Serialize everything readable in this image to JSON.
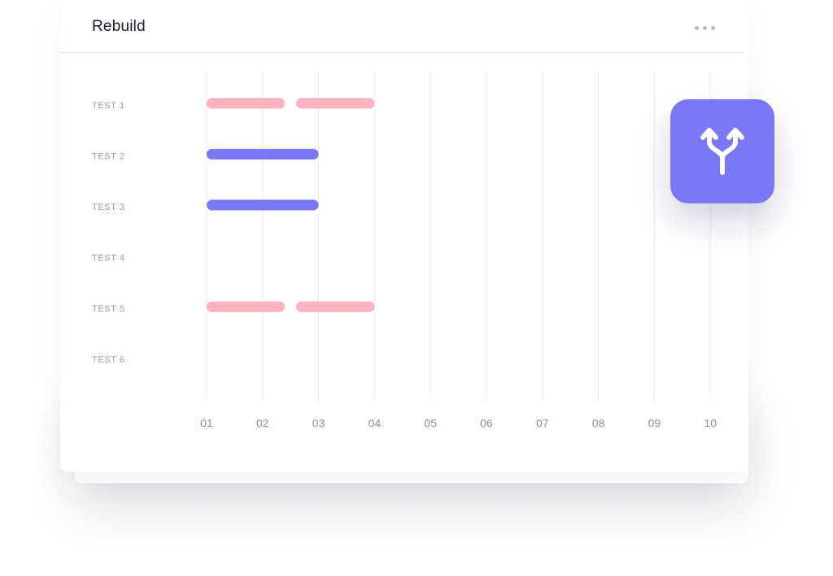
{
  "card": {
    "title": "Rebuild",
    "menu_icon": "more-horizontal-icon"
  },
  "fab": {
    "icon": "merge-split-arrows-icon",
    "color": "#7b76f3"
  },
  "colors": {
    "pink": "#ffb3c1",
    "purple": "#7b76f3"
  },
  "chart_data": {
    "type": "gantt",
    "rows": [
      "TEST 1",
      "TEST 2",
      "TEST 3",
      "TEST 4",
      "TEST 5",
      "TEST 6"
    ],
    "x_ticks": [
      "01",
      "02",
      "03",
      "04",
      "05",
      "06",
      "07",
      "08",
      "09",
      "10"
    ],
    "xlim": [
      1,
      10
    ],
    "grid": true,
    "bars": [
      {
        "row": 0,
        "start": 1,
        "end": 2.4,
        "color": "pink"
      },
      {
        "row": 0,
        "start": 2.6,
        "end": 4,
        "color": "pink"
      },
      {
        "row": 1,
        "start": 1,
        "end": 3,
        "color": "purple"
      },
      {
        "row": 2,
        "start": 1,
        "end": 3,
        "color": "purple"
      },
      {
        "row": 4,
        "start": 1,
        "end": 2.4,
        "color": "pink"
      },
      {
        "row": 4,
        "start": 2.6,
        "end": 4,
        "color": "pink"
      }
    ]
  }
}
